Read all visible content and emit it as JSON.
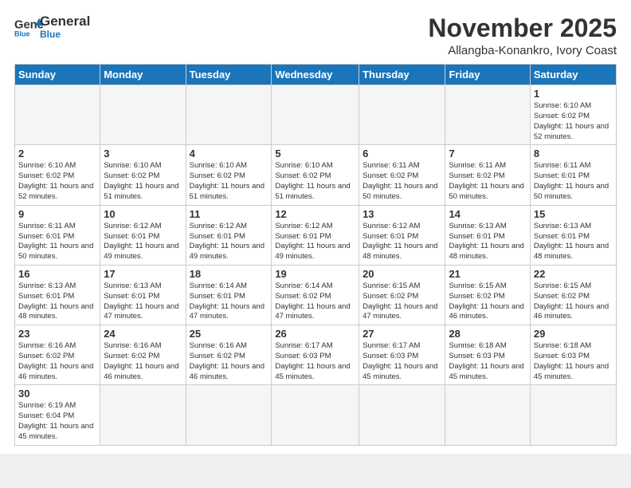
{
  "header": {
    "logo_general": "General",
    "logo_blue": "Blue",
    "month_title": "November 2025",
    "location": "Allangba-Konankro, Ivory Coast"
  },
  "weekdays": [
    "Sunday",
    "Monday",
    "Tuesday",
    "Wednesday",
    "Thursday",
    "Friday",
    "Saturday"
  ],
  "weeks": [
    [
      {
        "day": "",
        "empty": true
      },
      {
        "day": "",
        "empty": true
      },
      {
        "day": "",
        "empty": true
      },
      {
        "day": "",
        "empty": true
      },
      {
        "day": "",
        "empty": true
      },
      {
        "day": "",
        "empty": true
      },
      {
        "day": "1",
        "sunrise": "6:10 AM",
        "sunset": "6:02 PM",
        "daylight": "11 hours and 52 minutes."
      }
    ],
    [
      {
        "day": "2",
        "sunrise": "6:10 AM",
        "sunset": "6:02 PM",
        "daylight": "11 hours and 52 minutes."
      },
      {
        "day": "3",
        "sunrise": "6:10 AM",
        "sunset": "6:02 PM",
        "daylight": "11 hours and 51 minutes."
      },
      {
        "day": "4",
        "sunrise": "6:10 AM",
        "sunset": "6:02 PM",
        "daylight": "11 hours and 51 minutes."
      },
      {
        "day": "5",
        "sunrise": "6:10 AM",
        "sunset": "6:02 PM",
        "daylight": "11 hours and 51 minutes."
      },
      {
        "day": "6",
        "sunrise": "6:11 AM",
        "sunset": "6:02 PM",
        "daylight": "11 hours and 50 minutes."
      },
      {
        "day": "7",
        "sunrise": "6:11 AM",
        "sunset": "6:02 PM",
        "daylight": "11 hours and 50 minutes."
      },
      {
        "day": "8",
        "sunrise": "6:11 AM",
        "sunset": "6:01 PM",
        "daylight": "11 hours and 50 minutes."
      }
    ],
    [
      {
        "day": "9",
        "sunrise": "6:11 AM",
        "sunset": "6:01 PM",
        "daylight": "11 hours and 50 minutes."
      },
      {
        "day": "10",
        "sunrise": "6:12 AM",
        "sunset": "6:01 PM",
        "daylight": "11 hours and 49 minutes."
      },
      {
        "day": "11",
        "sunrise": "6:12 AM",
        "sunset": "6:01 PM",
        "daylight": "11 hours and 49 minutes."
      },
      {
        "day": "12",
        "sunrise": "6:12 AM",
        "sunset": "6:01 PM",
        "daylight": "11 hours and 49 minutes."
      },
      {
        "day": "13",
        "sunrise": "6:12 AM",
        "sunset": "6:01 PM",
        "daylight": "11 hours and 48 minutes."
      },
      {
        "day": "14",
        "sunrise": "6:13 AM",
        "sunset": "6:01 PM",
        "daylight": "11 hours and 48 minutes."
      },
      {
        "day": "15",
        "sunrise": "6:13 AM",
        "sunset": "6:01 PM",
        "daylight": "11 hours and 48 minutes."
      }
    ],
    [
      {
        "day": "16",
        "sunrise": "6:13 AM",
        "sunset": "6:01 PM",
        "daylight": "11 hours and 48 minutes."
      },
      {
        "day": "17",
        "sunrise": "6:13 AM",
        "sunset": "6:01 PM",
        "daylight": "11 hours and 47 minutes."
      },
      {
        "day": "18",
        "sunrise": "6:14 AM",
        "sunset": "6:01 PM",
        "daylight": "11 hours and 47 minutes."
      },
      {
        "day": "19",
        "sunrise": "6:14 AM",
        "sunset": "6:02 PM",
        "daylight": "11 hours and 47 minutes."
      },
      {
        "day": "20",
        "sunrise": "6:15 AM",
        "sunset": "6:02 PM",
        "daylight": "11 hours and 47 minutes."
      },
      {
        "day": "21",
        "sunrise": "6:15 AM",
        "sunset": "6:02 PM",
        "daylight": "11 hours and 46 minutes."
      },
      {
        "day": "22",
        "sunrise": "6:15 AM",
        "sunset": "6:02 PM",
        "daylight": "11 hours and 46 minutes."
      }
    ],
    [
      {
        "day": "23",
        "sunrise": "6:16 AM",
        "sunset": "6:02 PM",
        "daylight": "11 hours and 46 minutes."
      },
      {
        "day": "24",
        "sunrise": "6:16 AM",
        "sunset": "6:02 PM",
        "daylight": "11 hours and 46 minutes."
      },
      {
        "day": "25",
        "sunrise": "6:16 AM",
        "sunset": "6:02 PM",
        "daylight": "11 hours and 46 minutes."
      },
      {
        "day": "26",
        "sunrise": "6:17 AM",
        "sunset": "6:03 PM",
        "daylight": "11 hours and 45 minutes."
      },
      {
        "day": "27",
        "sunrise": "6:17 AM",
        "sunset": "6:03 PM",
        "daylight": "11 hours and 45 minutes."
      },
      {
        "day": "28",
        "sunrise": "6:18 AM",
        "sunset": "6:03 PM",
        "daylight": "11 hours and 45 minutes."
      },
      {
        "day": "29",
        "sunrise": "6:18 AM",
        "sunset": "6:03 PM",
        "daylight": "11 hours and 45 minutes."
      }
    ],
    [
      {
        "day": "30",
        "sunrise": "6:19 AM",
        "sunset": "6:04 PM",
        "daylight": "11 hours and 45 minutes."
      },
      {
        "day": "",
        "empty": true
      },
      {
        "day": "",
        "empty": true
      },
      {
        "day": "",
        "empty": true
      },
      {
        "day": "",
        "empty": true
      },
      {
        "day": "",
        "empty": true
      },
      {
        "day": "",
        "empty": true
      }
    ]
  ]
}
